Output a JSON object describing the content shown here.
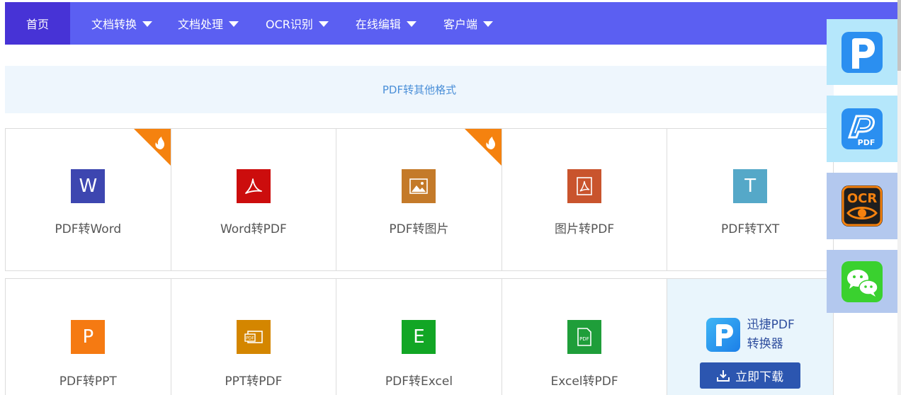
{
  "nav": {
    "home": "首页",
    "items": [
      {
        "label": "文档转换"
      },
      {
        "label": "文档处理"
      },
      {
        "label": "OCR识别"
      },
      {
        "label": "在线编辑"
      },
      {
        "label": "客户端"
      }
    ]
  },
  "section": {
    "title": "PDF转其他格式"
  },
  "tools": {
    "row1": [
      {
        "label": "PDF转Word",
        "icon": "word-icon",
        "glyph": "W",
        "color": "#3d46b0",
        "hot": true
      },
      {
        "label": "Word转PDF",
        "icon": "acrobat-icon",
        "glyph": "",
        "color": "#cc0d0d",
        "hot": false
      },
      {
        "label": "PDF转图片",
        "icon": "image-icon",
        "glyph": "",
        "color": "#c47a29",
        "hot": true
      },
      {
        "label": "图片转PDF",
        "icon": "acrobat-icon",
        "glyph": "",
        "color": "#c9542d",
        "hot": false
      },
      {
        "label": "PDF转TXT",
        "icon": "text-icon",
        "glyph": "T",
        "color": "#55a8c8",
        "hot": false
      }
    ],
    "row2": [
      {
        "label": "PDF转PPT",
        "icon": "powerpoint-icon",
        "glyph": "P",
        "color": "#f57a12"
      },
      {
        "label": "PPT转PDF",
        "icon": "pdf-slide-icon",
        "glyph": "",
        "color": "#d48600"
      },
      {
        "label": "PDF转Excel",
        "icon": "excel-icon",
        "glyph": "E",
        "color": "#12a625"
      },
      {
        "label": "Excel转PDF",
        "icon": "pdf-file-icon",
        "glyph": "",
        "color": "#1f9e3a"
      }
    ]
  },
  "promo": {
    "name_line1": "迅捷PDF",
    "name_line2": "转换器",
    "download": "立即下载"
  },
  "sidebar": {
    "items": [
      {
        "icon": "xunjie-pdf-app-icon"
      },
      {
        "icon": "pdf-editor-app-icon",
        "badge": "PDF"
      },
      {
        "icon": "ocr-app-icon",
        "badge": "OCR"
      },
      {
        "icon": "wechat-icon"
      }
    ]
  }
}
